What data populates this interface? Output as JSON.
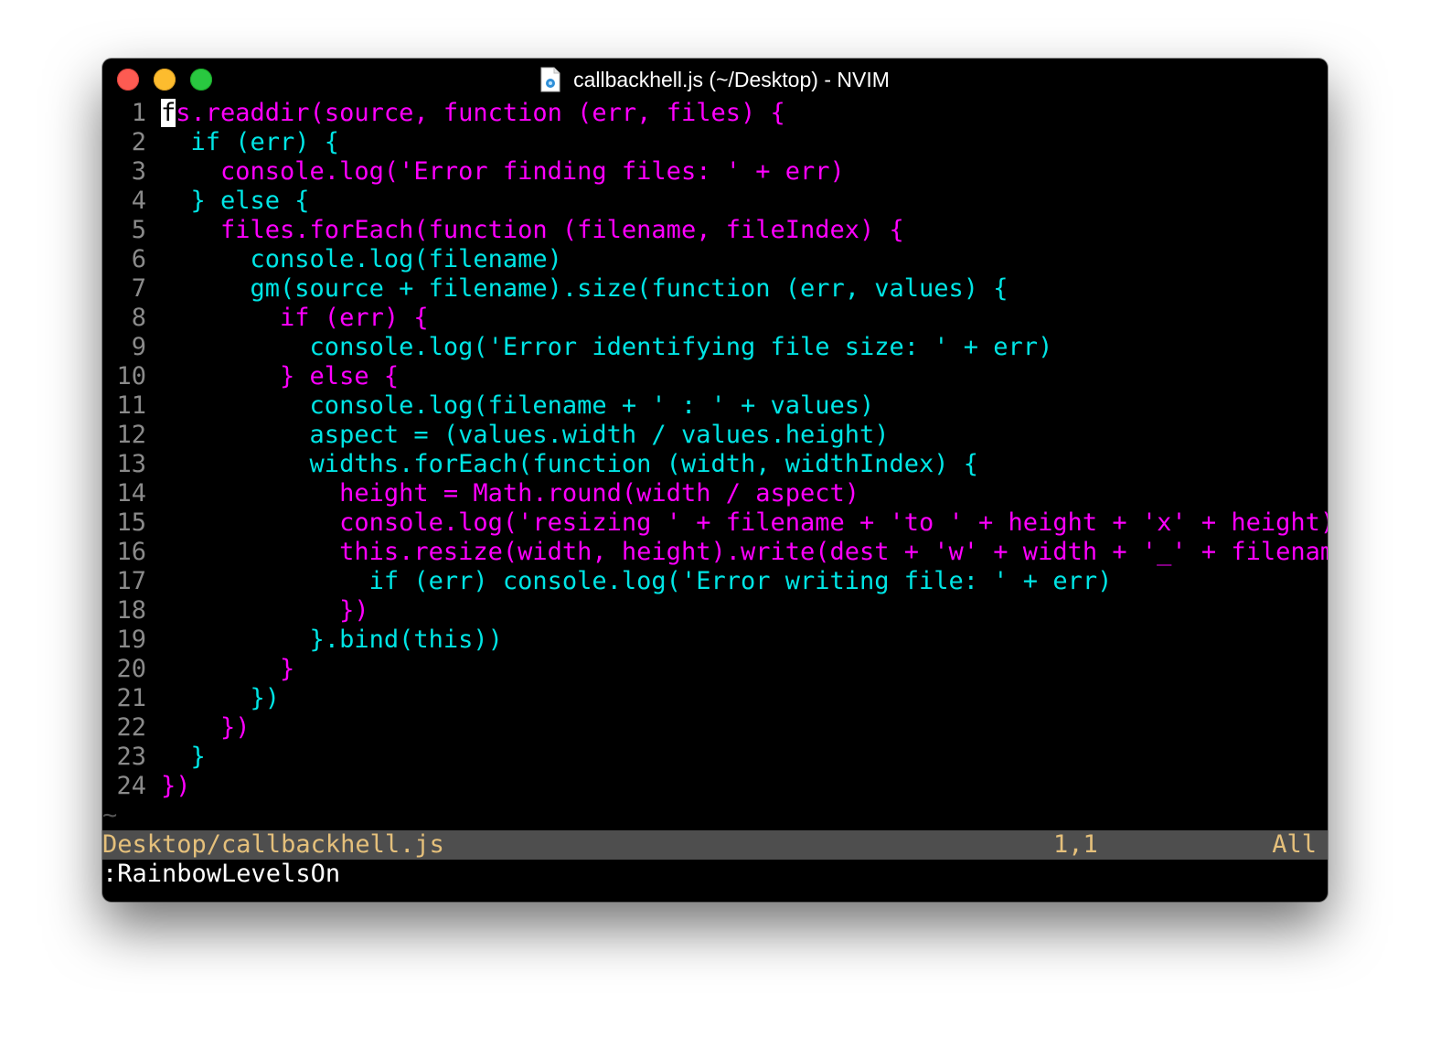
{
  "window": {
    "title": "callbackhell.js (~/Desktop) - NVIM",
    "controls": [
      "close",
      "minimize",
      "maximize"
    ]
  },
  "colors": {
    "level_a": "#ff00ff",
    "level_b": "#00e5e5",
    "line_number": "#8a8a8a",
    "status_bg": "#4e4e4e",
    "status_fg": "#e5c07b"
  },
  "editor": {
    "lines": [
      {
        "num": "1",
        "indent": "",
        "text": "fs.readdir(source, function (err, files) {",
        "color": "magenta"
      },
      {
        "num": "2",
        "indent": "  ",
        "text": "if (err) {",
        "color": "cyan"
      },
      {
        "num": "3",
        "indent": "    ",
        "text": "console.log('Error finding files: ' + err)",
        "color": "magenta"
      },
      {
        "num": "4",
        "indent": "  ",
        "text": "} else {",
        "color": "cyan"
      },
      {
        "num": "5",
        "indent": "    ",
        "text": "files.forEach(function (filename, fileIndex) {",
        "color": "magenta"
      },
      {
        "num": "6",
        "indent": "      ",
        "text": "console.log(filename)",
        "color": "cyan"
      },
      {
        "num": "7",
        "indent": "      ",
        "text": "gm(source + filename).size(function (err, values) {",
        "color": "cyan"
      },
      {
        "num": "8",
        "indent": "        ",
        "text": "if (err) {",
        "color": "magenta"
      },
      {
        "num": "9",
        "indent": "          ",
        "text": "console.log('Error identifying file size: ' + err)",
        "color": "cyan"
      },
      {
        "num": "10",
        "indent": "        ",
        "text": "} else {",
        "color": "magenta"
      },
      {
        "num": "11",
        "indent": "          ",
        "text": "console.log(filename + ' : ' + values)",
        "color": "cyan"
      },
      {
        "num": "12",
        "indent": "          ",
        "text": "aspect = (values.width / values.height)",
        "color": "cyan"
      },
      {
        "num": "13",
        "indent": "          ",
        "text": "widths.forEach(function (width, widthIndex) {",
        "color": "cyan"
      },
      {
        "num": "14",
        "indent": "            ",
        "text": "height = Math.round(width / aspect)",
        "color": "magenta"
      },
      {
        "num": "15",
        "indent": "            ",
        "text": "console.log('resizing ' + filename + 'to ' + height + 'x' + height)",
        "color": "magenta"
      },
      {
        "num": "16",
        "indent": "            ",
        "text": "this.resize(width, height).write(dest + 'w' + width + '_' + filenam",
        "color": "magenta"
      },
      {
        "num": "17",
        "indent": "              ",
        "text": "if (err) console.log('Error writing file: ' + err)",
        "color": "cyan"
      },
      {
        "num": "18",
        "indent": "            ",
        "text": "})",
        "color": "magenta"
      },
      {
        "num": "19",
        "indent": "          ",
        "text": "}.bind(this))",
        "color": "cyan"
      },
      {
        "num": "20",
        "indent": "        ",
        "text": "}",
        "color": "magenta"
      },
      {
        "num": "21",
        "indent": "      ",
        "text": "})",
        "color": "cyan"
      },
      {
        "num": "22",
        "indent": "    ",
        "text": "})",
        "color": "magenta"
      },
      {
        "num": "23",
        "indent": "  ",
        "text": "}",
        "color": "cyan"
      },
      {
        "num": "24",
        "indent": "",
        "text": "})",
        "color": "magenta"
      }
    ],
    "empty_line_marker": "~"
  },
  "statusline": {
    "file": "Desktop/callbackhell.js",
    "position": "1,1",
    "scroll": "All"
  },
  "cmdline": {
    "text": ":RainbowLevelsOn"
  }
}
